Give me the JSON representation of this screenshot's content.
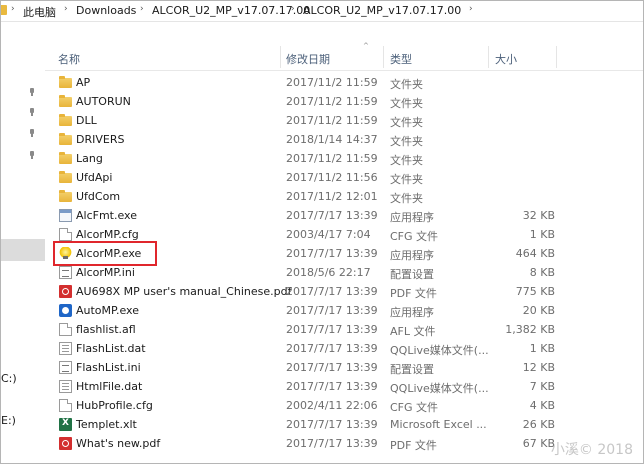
{
  "address": {
    "segments": [
      "此电脑",
      "Downloads",
      "ALCOR_U2_MP_v17.07.17.00",
      "ALCOR_U2_MP_v17.07.17.00"
    ]
  },
  "nav": {
    "drive_labels": [
      "C:)",
      "E:)"
    ]
  },
  "columns": {
    "name": "名称",
    "date": "修改日期",
    "type": "类型",
    "size": "大小"
  },
  "files": [
    {
      "name": "AP",
      "date": "2017/11/2 11:59",
      "type": "文件夹",
      "size": "",
      "icon": "folder-icon"
    },
    {
      "name": "AUTORUN",
      "date": "2017/11/2 11:59",
      "type": "文件夹",
      "size": "",
      "icon": "folder-icon"
    },
    {
      "name": "DLL",
      "date": "2017/11/2 11:59",
      "type": "文件夹",
      "size": "",
      "icon": "folder-icon"
    },
    {
      "name": "DRIVERS",
      "date": "2018/1/14 14:37",
      "type": "文件夹",
      "size": "",
      "icon": "folder-icon"
    },
    {
      "name": "Lang",
      "date": "2017/11/2 11:59",
      "type": "文件夹",
      "size": "",
      "icon": "folder-icon"
    },
    {
      "name": "UfdApi",
      "date": "2017/11/2 11:56",
      "type": "文件夹",
      "size": "",
      "icon": "folder-icon"
    },
    {
      "name": "UfdCom",
      "date": "2017/11/2 12:01",
      "type": "文件夹",
      "size": "",
      "icon": "folder-icon"
    },
    {
      "name": "AlcFmt.exe",
      "date": "2017/7/17 13:39",
      "type": "应用程序",
      "size": "32 KB",
      "icon": "exe-icon"
    },
    {
      "name": "AlcorMP.cfg",
      "date": "2003/4/17 7:04",
      "type": "CFG 文件",
      "size": "1 KB",
      "icon": "file-icon"
    },
    {
      "name": "AlcorMP.exe",
      "date": "2017/7/17 13:39",
      "type": "应用程序",
      "size": "464 KB",
      "icon": "lightbulb-icon"
    },
    {
      "name": "AlcorMP.ini",
      "date": "2018/5/6 22:17",
      "type": "配置设置",
      "size": "8 KB",
      "icon": "ini-icon"
    },
    {
      "name": "AU698X MP user's manual_Chinese.pdf",
      "date": "2017/7/17 13:39",
      "type": "PDF 文件",
      "size": "775 KB",
      "icon": "pdf-icon"
    },
    {
      "name": "AutoMP.exe",
      "date": "2017/7/17 13:39",
      "type": "应用程序",
      "size": "20 KB",
      "icon": "app-icon"
    },
    {
      "name": "flashlist.afl",
      "date": "2017/7/17 13:39",
      "type": "AFL 文件",
      "size": "1,382 KB",
      "icon": "file-icon"
    },
    {
      "name": "FlashList.dat",
      "date": "2017/7/17 13:39",
      "type": "QQLive媒体文件(...",
      "size": "1 KB",
      "icon": "dat-icon"
    },
    {
      "name": "FlashList.ini",
      "date": "2017/7/17 13:39",
      "type": "配置设置",
      "size": "12 KB",
      "icon": "ini-icon"
    },
    {
      "name": "HtmlFile.dat",
      "date": "2017/7/17 13:39",
      "type": "QQLive媒体文件(...",
      "size": "7 KB",
      "icon": "dat-icon"
    },
    {
      "name": "HubProfile.cfg",
      "date": "2002/4/11 22:06",
      "type": "CFG 文件",
      "size": "4 KB",
      "icon": "file-icon"
    },
    {
      "name": "Templet.xlt",
      "date": "2017/7/17 13:39",
      "type": "Microsoft Excel ...",
      "size": "26 KB",
      "icon": "excel-icon"
    },
    {
      "name": "What's new.pdf",
      "date": "2017/7/17 13:39",
      "type": "PDF 文件",
      "size": "67 KB",
      "icon": "pdf-icon"
    }
  ],
  "watermark": "小溪© 2018",
  "colors": {
    "folder": "#e8b43a",
    "highlight": "#e0262c",
    "header_text": "#4c607a",
    "meta_text": "#6d6d6d"
  }
}
